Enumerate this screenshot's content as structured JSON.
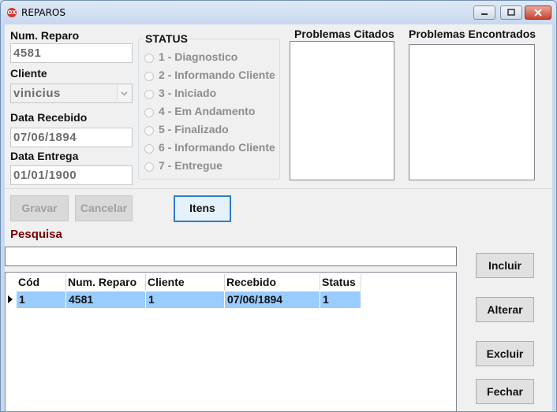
{
  "window": {
    "title": "REPAROS",
    "icon": "app-icon"
  },
  "form": {
    "num_reparo_label": "Num. Reparo",
    "num_reparo_value": "4581",
    "cliente_label": "Cliente",
    "cliente_value": "vinicius",
    "data_recebido_label": "Data Recebido",
    "data_recebido_value": "07/06/1894",
    "data_entrega_label": "Data Entrega",
    "data_entrega_value": "01/01/1900"
  },
  "status": {
    "title": "STATUS",
    "options": [
      "1 - Diagnostico",
      "2 - Informando Cliente",
      "3 - Iniciado",
      "4 - Em Andamento",
      "5 - Finalizado",
      "6 - Informando Cliente",
      "7 - Entregue"
    ]
  },
  "problemas": {
    "citados_label": "Problemas Citados",
    "encontrados_label": "Problemas Encontrados"
  },
  "buttons": {
    "gravar": "Gravar",
    "cancelar": "Cancelar",
    "itens": "Itens",
    "incluir": "Incluir",
    "alterar": "Alterar",
    "excluir": "Excluir",
    "fechar": "Fechar"
  },
  "search": {
    "label": "Pesquisa",
    "value": ""
  },
  "grid": {
    "columns": [
      "Cód",
      "Num. Reparo",
      "Cliente",
      "Recebido",
      "Status"
    ],
    "rows": [
      [
        "1",
        "4581",
        "1",
        "07/06/1894",
        "1"
      ]
    ]
  }
}
